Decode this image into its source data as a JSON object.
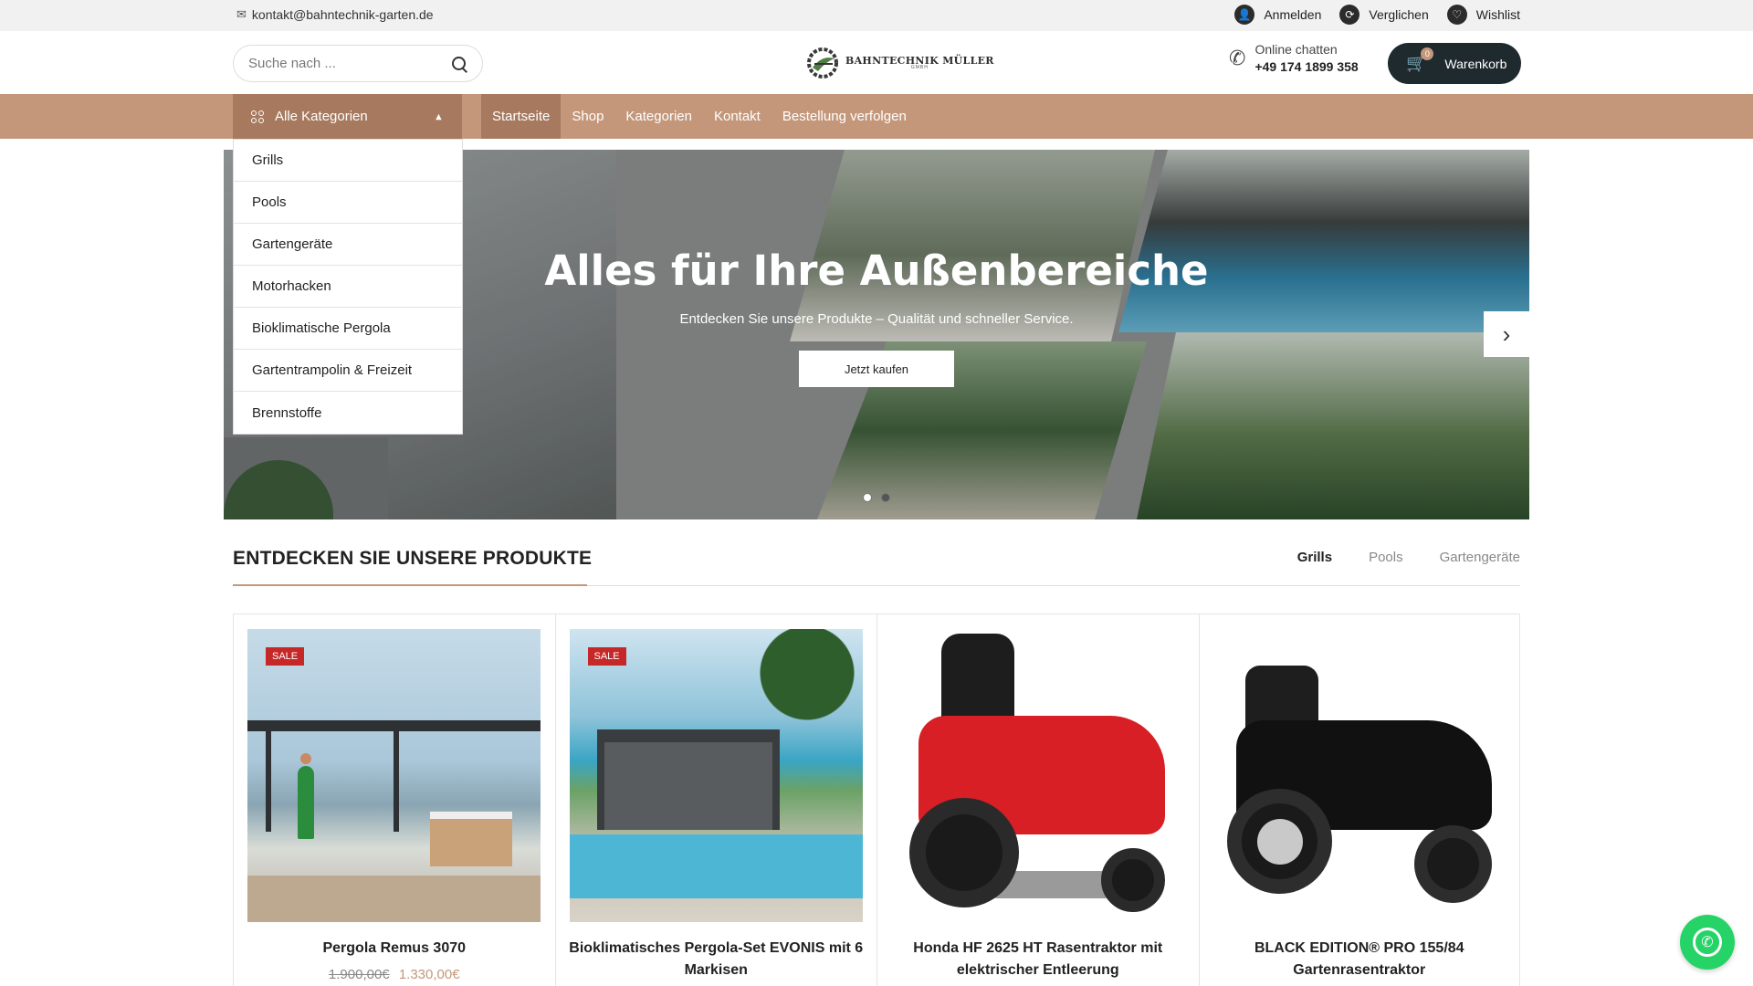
{
  "topbar": {
    "email": "kontakt@bahntechnik-garten.de",
    "links": [
      {
        "label": "Anmelden",
        "icon": "user-icon"
      },
      {
        "label": "Verglichen",
        "icon": "compare-icon"
      },
      {
        "label": "Wishlist",
        "icon": "heart-icon"
      }
    ]
  },
  "header": {
    "search_placeholder": "Suche nach ...",
    "logo": {
      "brand": "BAHNTECHNIK MÜLLER",
      "sub": "GMBH"
    },
    "chat": {
      "label": "Online chatten",
      "phone": "+49 174 1899 358"
    },
    "cart": {
      "label": "Warenkorb",
      "count": "0"
    }
  },
  "nav": {
    "all_categories": "Alle Kategorien",
    "links": [
      "Startseite",
      "Shop",
      "Kategorien",
      "Kontakt",
      "Bestellung verfolgen"
    ],
    "active": "Startseite"
  },
  "categories": [
    "Grills",
    "Pools",
    "Gartengeräte",
    "Motorhacken",
    "Bioklimatische Pergola",
    "Gartentrampolin & Freizeit",
    "Brennstoffe"
  ],
  "hero": {
    "title": "Alles für Ihre Außenbereiche",
    "subtitle": "Entdecken Sie unsere Produkte – Qualität und schneller Service.",
    "button": "Jetzt kaufen",
    "slides": 2,
    "active_slide": 1
  },
  "products_section": {
    "title": "ENTDECKEN SIE UNSERE PRODUKTE",
    "tabs": [
      "Grills",
      "Pools",
      "Gartengeräte"
    ],
    "active_tab": "Grills"
  },
  "products": [
    {
      "name": "Pergola Remus 3070",
      "badge": "SALE",
      "price_old": "1.900,00€",
      "price_new": "1.330,00€"
    },
    {
      "name": "Bioklimatisches Pergola-Set EVONIS mit 6 Markisen",
      "badge": "SALE",
      "price_old": "",
      "price_new": ""
    },
    {
      "name": "Honda HF 2625 HT Rasentraktor mit elektrischer Entleerung",
      "badge": "",
      "price_old": "",
      "price_new": ""
    },
    {
      "name": "BLACK EDITION® PRO 155/84 Gartenrasentraktor",
      "badge": "",
      "price_old": "",
      "price_new": ""
    }
  ],
  "colors": {
    "accent": "#c4977a",
    "accent_dark": "#a77a5f",
    "sale": "#c62828",
    "cart": "#1f2a2e",
    "whatsapp": "#25d366"
  }
}
